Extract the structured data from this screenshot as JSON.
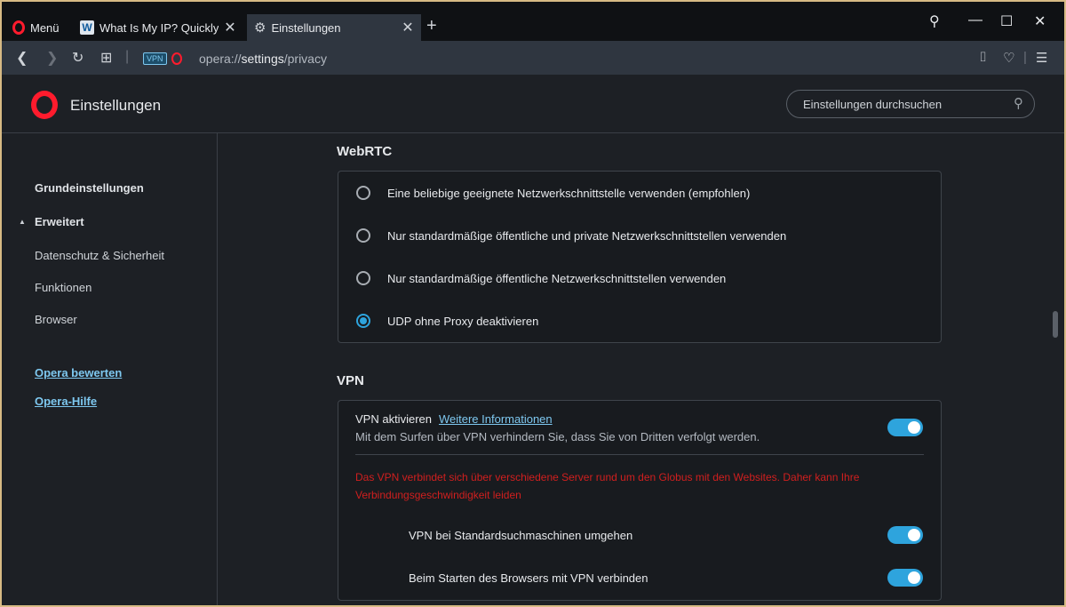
{
  "tabs": {
    "menu_label": "Menü",
    "tab1_title": "What Is My IP? Quickly See",
    "tab1_favicon": "W",
    "tab2_title": "Einstellungen"
  },
  "address": {
    "vpn_badge": "VPN",
    "url_scheme": "opera://",
    "url_host": "settings",
    "url_path": "/privacy"
  },
  "header": {
    "title": "Einstellungen",
    "search_placeholder": "Einstellungen durchsuchen"
  },
  "sidebar": {
    "items": [
      "Grundeinstellungen",
      "Erweitert",
      "Datenschutz & Sicherheit",
      "Funktionen",
      "Browser"
    ],
    "links": [
      "Opera bewerten",
      "Opera-Hilfe"
    ]
  },
  "webrtc": {
    "title": "WebRTC",
    "options": [
      "Eine beliebige geeignete Netzwerkschnittstelle verwenden (empfohlen)",
      "Nur standardmäßige öffentliche und private Netzwerkschnittstellen verwenden",
      "Nur standardmäßige öffentliche Netzwerkschnittstellen verwenden",
      "UDP ohne Proxy deaktivieren"
    ],
    "selected_index": 3
  },
  "vpn": {
    "title": "VPN",
    "enable_label": "VPN aktivieren",
    "more_info": "Weitere Informationen",
    "description": "Mit dem Surfen über VPN verhindern Sie, dass Sie von Dritten verfolgt werden.",
    "warning": "Das VPN verbindet sich über verschiedene Server rund um den Globus mit den Websites. Daher kann Ihre Verbindungsgeschwindigkeit leiden",
    "bypass_label": "VPN bei Standardsuchmaschinen umgehen",
    "connect_on_start_label": "Beim Starten des Browsers mit VPN verbinden",
    "enabled": true,
    "bypass_enabled": true,
    "connect_on_start_enabled": true
  },
  "colors": {
    "accent": "#2ea4dd",
    "opera_red": "#ff1b2d",
    "warning": "#d11f1f"
  }
}
